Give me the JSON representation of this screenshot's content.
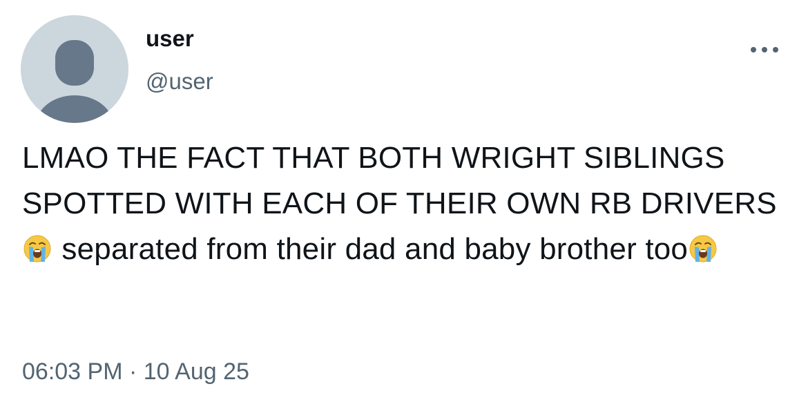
{
  "user": {
    "name": "user",
    "handle": "@user"
  },
  "tweet": {
    "line1": "LMAO THE FACT THAT BOTH WRIGHT SIBLINGS SPOTTED WITH EACH OF THEIR OWN RB DRIVERS",
    "line2": " separated from their dad and baby brother too",
    "emoji": "loudly-crying-face"
  },
  "meta": {
    "time": "06:03 PM",
    "separator": "·",
    "date": "10 Aug 25"
  },
  "icons": {
    "avatar": "default-avatar-icon",
    "more": "more-options-icon"
  },
  "colors": {
    "text": "#0f1419",
    "secondary": "#536471",
    "avatar_bg": "#ccd6dd",
    "avatar_fg": "#66788a"
  }
}
